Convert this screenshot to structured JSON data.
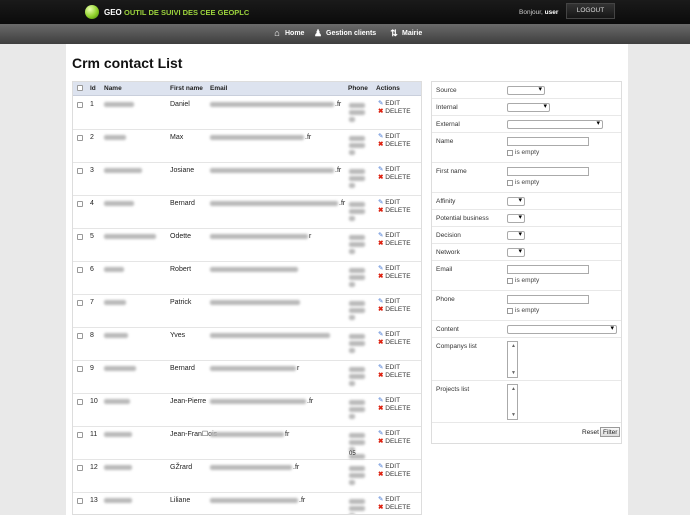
{
  "header": {
    "logo_geo": "GEO",
    "logo_sub": "OUTIL DE SUIVI DES CEE GEOPLC",
    "greeting": "Bonjour,",
    "user": "user",
    "logout": "LOGOUT"
  },
  "nav": {
    "home": "Home",
    "clients": "Gestion clients",
    "mairie": "Mairie"
  },
  "page_title": "Crm contact List",
  "table": {
    "headers": {
      "id": "Id",
      "name": "Name",
      "first_name": "First name",
      "email": "Email",
      "phone": "Phone",
      "actions": "Actions"
    },
    "edit": "EDIT",
    "delete": "DELETE",
    "rows": [
      {
        "id": "1",
        "first_name": "Daniel",
        "email_tld": ".fr"
      },
      {
        "id": "2",
        "first_name": "Max",
        "email_tld": ".fr"
      },
      {
        "id": "3",
        "first_name": "Josiane",
        "email_tld": ".fr"
      },
      {
        "id": "4",
        "first_name": "Bernard",
        "email_tld": ".fr"
      },
      {
        "id": "5",
        "first_name": "Odette",
        "email_tld": "r"
      },
      {
        "id": "6",
        "first_name": "Robert",
        "email_tld": ""
      },
      {
        "id": "7",
        "first_name": "Patrick",
        "email_tld": ""
      },
      {
        "id": "8",
        "first_name": "Yves",
        "email_tld": ""
      },
      {
        "id": "9",
        "first_name": "Bernard",
        "email_tld": "r"
      },
      {
        "id": "10",
        "first_name": "Jean-Pierre",
        "email_tld": ".fr"
      },
      {
        "id": "11",
        "first_name": "Jean-Fran☐ois",
        "email_tld": "fr"
      },
      {
        "id": "12",
        "first_name": "GŽrard",
        "email_tld": ".fr"
      },
      {
        "id": "13",
        "first_name": "Liliane",
        "email_tld": ".fr"
      }
    ],
    "row11_phone_suffix": "05"
  },
  "filters": {
    "source": "Source",
    "internal": "Internal",
    "external": "External",
    "name": "Name",
    "first_name": "First name",
    "affinity": "Affinity",
    "potential_business": "Potential business",
    "decision": "Decision",
    "network": "Network",
    "email": "Email",
    "phone": "Phone",
    "content": "Content",
    "companys_list": "Companys list",
    "projects_list": "Projects list",
    "is_empty": "is empty",
    "reset": "Reset",
    "filter": "Filter"
  },
  "colors": {
    "accent": "#9bd23c",
    "header_bg": "#111111",
    "nav_bg": "#555555",
    "table_head": "#dde3ef"
  }
}
